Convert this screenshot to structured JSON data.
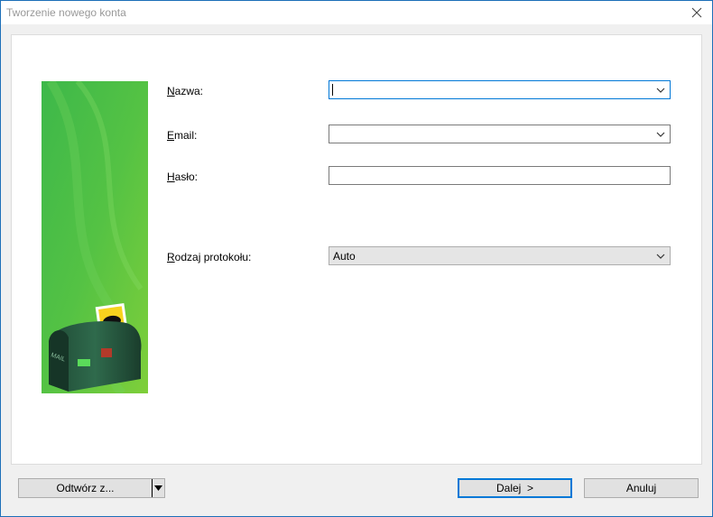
{
  "window": {
    "title": "Tworzenie nowego konta"
  },
  "form": {
    "name_label_accel": "N",
    "name_label_rest": "azwa:",
    "name_value": "",
    "email_label_accel": "E",
    "email_label_rest": "mail:",
    "email_value": "",
    "password_label_accel": "H",
    "password_label_rest": "asło:",
    "password_value": "",
    "protocol_label_accel": "R",
    "protocol_label_rest": "odzaj protokołu:",
    "protocol_value": "Auto"
  },
  "buttons": {
    "open_from": "Odtwórz z...",
    "next": "Dalej  >",
    "cancel": "Anuluj"
  },
  "banner": {
    "mailbox_text": "MAIL"
  },
  "icons": [
    "close-icon",
    "chevron-down-icon",
    "split-dropdown-arrow-icon"
  ]
}
